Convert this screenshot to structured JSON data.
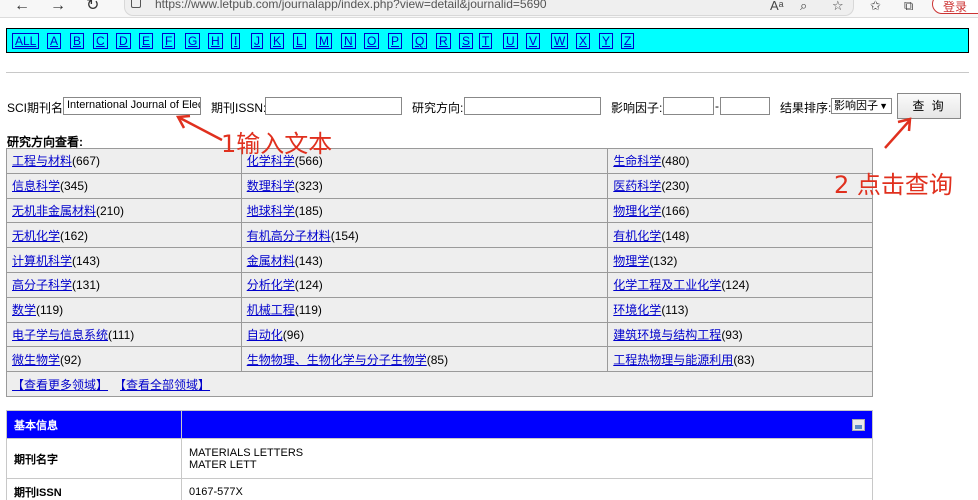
{
  "browser": {
    "url": "https://www.letpub.com/journalapp/index.php?view=detail&journalid=5690",
    "profile_label": "登录"
  },
  "alphabet": [
    "ALL",
    "A",
    "B",
    "C",
    "D",
    "E",
    "F",
    "G",
    "H",
    "I",
    "J",
    "K",
    "L",
    "M",
    "N",
    "O",
    "P",
    "Q",
    "R",
    "S",
    "T",
    "U",
    "V",
    "W",
    "X",
    "Y",
    "Z"
  ],
  "search": {
    "journal_label": "SCI期刊名:",
    "journal_value": "International Journal of Elec",
    "issn_label": "期刊ISSN:",
    "issn_value": "",
    "field_label": "研究方向:",
    "field_value": "",
    "if_label": "影响因子:",
    "if_min": "",
    "if_dash": "-",
    "if_max": "",
    "sort_label": "结果排序:",
    "sort_value": "影响因子",
    "query_button": "查 询"
  },
  "research": {
    "title": "研究方向查看:",
    "rows": [
      [
        {
          "name": "工程与材料",
          "count": "(667)"
        },
        {
          "name": "化学科学",
          "count": "(566)"
        },
        {
          "name": "生命科学",
          "count": "(480)"
        }
      ],
      [
        {
          "name": "信息科学",
          "count": "(345)"
        },
        {
          "name": "数理科学",
          "count": "(323)"
        },
        {
          "name": "医药科学",
          "count": "(230)"
        }
      ],
      [
        {
          "name": "无机非金属材料",
          "count": "(210)"
        },
        {
          "name": "地球科学",
          "count": "(185)"
        },
        {
          "name": "物理化学",
          "count": "(166)"
        }
      ],
      [
        {
          "name": "无机化学",
          "count": "(162)"
        },
        {
          "name": "有机高分子材料",
          "count": "(154)"
        },
        {
          "name": "有机化学",
          "count": "(148)"
        }
      ],
      [
        {
          "name": "计算机科学",
          "count": "(143)"
        },
        {
          "name": "金属材料",
          "count": "(143)"
        },
        {
          "name": "物理学",
          "count": "(132)"
        }
      ],
      [
        {
          "name": "高分子科学",
          "count": "(131)"
        },
        {
          "name": "分析化学",
          "count": "(124)"
        },
        {
          "name": "化学工程及工业化学",
          "count": "(124)"
        }
      ],
      [
        {
          "name": "数学",
          "count": "(119)"
        },
        {
          "name": "机械工程",
          "count": "(119)"
        },
        {
          "name": "环境化学",
          "count": "(113)"
        }
      ],
      [
        {
          "name": "电子学与信息系统",
          "count": "(111)"
        },
        {
          "name": "自动化",
          "count": "(96)"
        },
        {
          "name": "建筑环境与结构工程",
          "count": "(93)"
        }
      ],
      [
        {
          "name": "微生物学",
          "count": "(92)"
        },
        {
          "name": "生物物理、生物化学与分子生物学",
          "count": "(85)"
        },
        {
          "name": "工程热物理与能源利用",
          "count": "(83)"
        }
      ]
    ],
    "more_link": "【查看更多领域】",
    "all_link": "【查看全部领域】"
  },
  "info": {
    "header": "基本信息",
    "name_label": "期刊名字",
    "name_full": "MATERIALS LETTERS",
    "name_abbr": "MATER LETT",
    "issn_label": "期刊ISSN",
    "issn_value": "0167-577X"
  },
  "annotations": {
    "step1": "1输入文本",
    "step2": "2 点击查询",
    "color": "#e0301e"
  }
}
